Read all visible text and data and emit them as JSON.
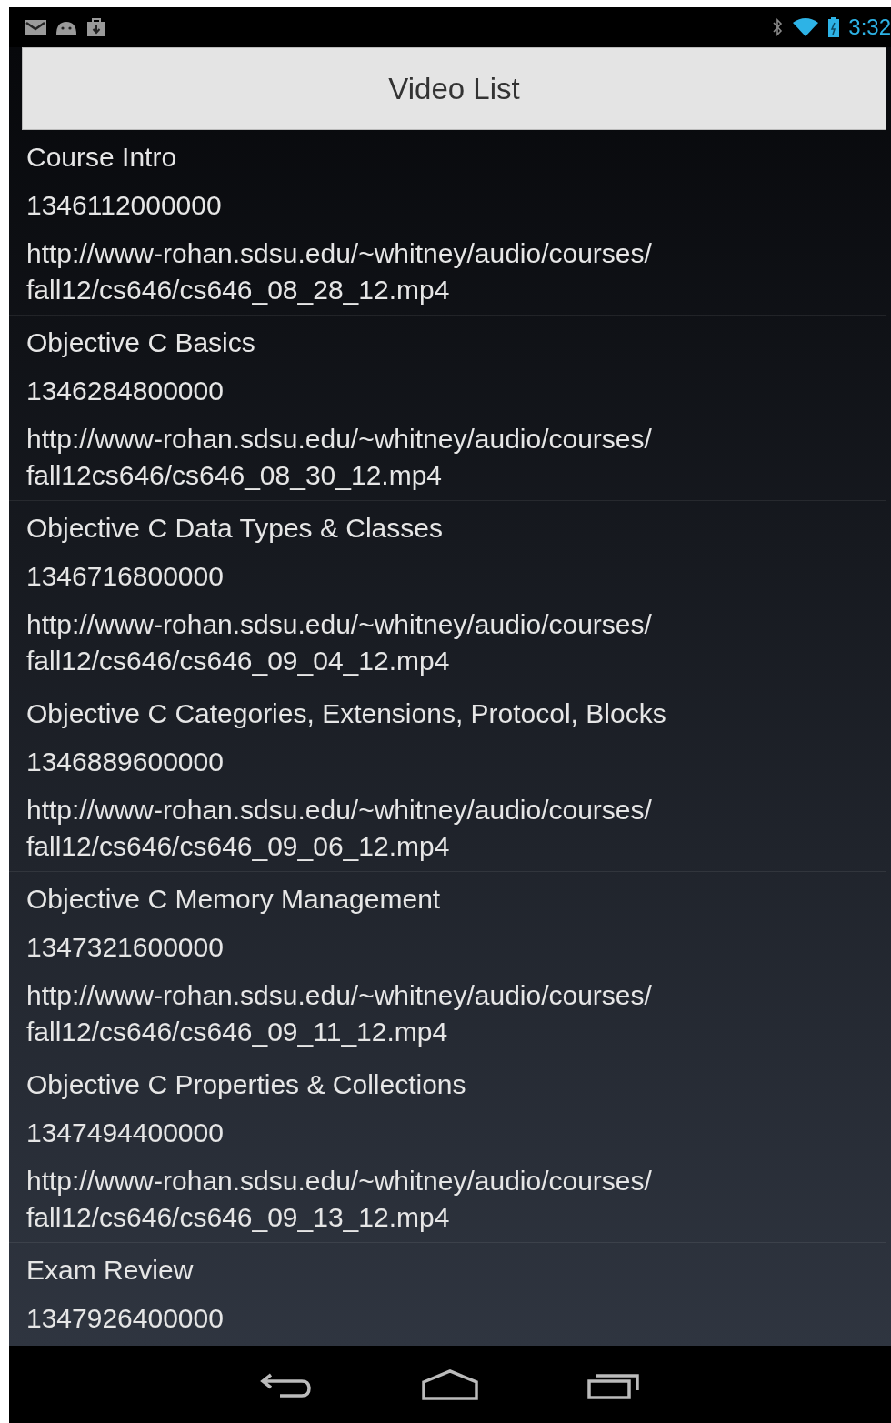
{
  "status_bar": {
    "time": "3:32"
  },
  "header_button": {
    "label": "Video List"
  },
  "videos": [
    {
      "title": "Course Intro",
      "timestamp": "1346112000000",
      "url": "http://www-rohan.sdsu.edu/~whitney/audio/courses/fall12/cs646/cs646_08_28_12.mp4"
    },
    {
      "title": "Objective C Basics",
      "timestamp": "1346284800000",
      "url": "http://www-rohan.sdsu.edu/~whitney/audio/courses/fall12cs646/cs646_08_30_12.mp4"
    },
    {
      "title": "Objective C Data Types & Classes",
      "timestamp": "1346716800000",
      "url": "http://www-rohan.sdsu.edu/~whitney/audio/courses/fall12/cs646/cs646_09_04_12.mp4"
    },
    {
      "title": "Objective C Categories, Extensions, Protocol, Blocks",
      "timestamp": "1346889600000",
      "url": "http://www-rohan.sdsu.edu/~whitney/audio/courses/fall12/cs646/cs646_09_06_12.mp4"
    },
    {
      "title": "Objective C Memory Management",
      "timestamp": "1347321600000",
      "url": "http://www-rohan.sdsu.edu/~whitney/audio/courses/fall12/cs646/cs646_09_11_12.mp4"
    },
    {
      "title": "Objective C Properties & Collections",
      "timestamp": "1347494400000",
      "url": "http://www-rohan.sdsu.edu/~whitney/audio/courses/fall12/cs646/cs646_09_13_12.mp4"
    },
    {
      "title": "Exam Review",
      "timestamp": "1347926400000"
    }
  ]
}
